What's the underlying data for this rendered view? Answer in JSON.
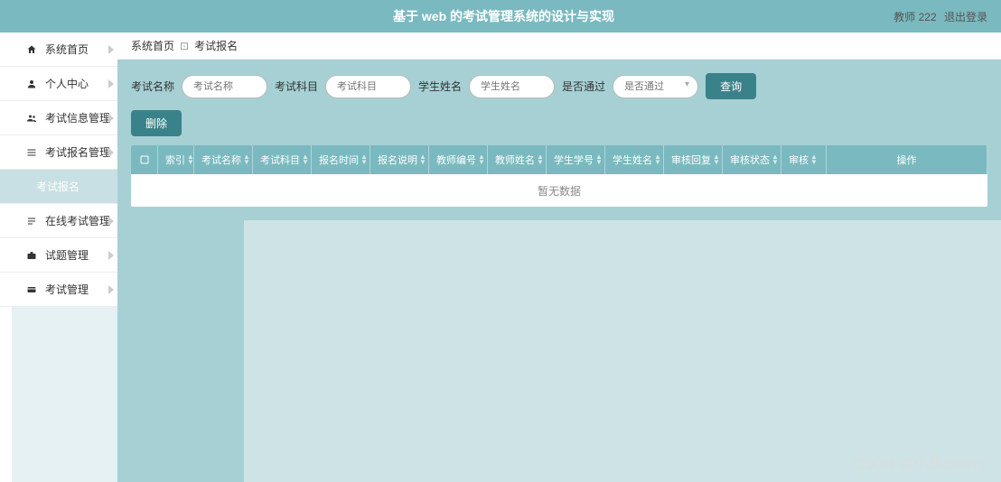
{
  "header": {
    "title": "基于 web 的考试管理系统的设计与实现",
    "user": "教师 222",
    "logout": "退出登录"
  },
  "sidebar": {
    "items": [
      {
        "label": "系统首页",
        "icon": "home"
      },
      {
        "label": "个人中心",
        "icon": "user"
      },
      {
        "label": "考试信息管理",
        "icon": "users"
      },
      {
        "label": "考试报名管理",
        "icon": "list"
      },
      {
        "label": "考试报名",
        "icon": "",
        "sub": true
      },
      {
        "label": "在线考试管理",
        "icon": "bars"
      },
      {
        "label": "试题管理",
        "icon": "briefcase"
      },
      {
        "label": "考试管理",
        "icon": "card"
      }
    ]
  },
  "breadcrumb": {
    "home": "系统首页",
    "current": "考试报名"
  },
  "search": {
    "label1": "考试名称",
    "ph1": "考试名称",
    "label2": "考试科目",
    "ph2": "考试科目",
    "label3": "学生姓名",
    "ph3": "学生姓名",
    "label4": "是否通过",
    "ph4": "是否通过",
    "btn_search": "查询",
    "btn_delete": "删除"
  },
  "table": {
    "headers": [
      "索引",
      "考试名称",
      "考试科目",
      "报名时间",
      "报名说明",
      "教师编号",
      "教师姓名",
      "学生学号",
      "学生姓名",
      "审核回复",
      "审核状态",
      "审核",
      "操作"
    ],
    "empty": "暂无数据"
  },
  "watermark": "CSDN @小蔡coding"
}
